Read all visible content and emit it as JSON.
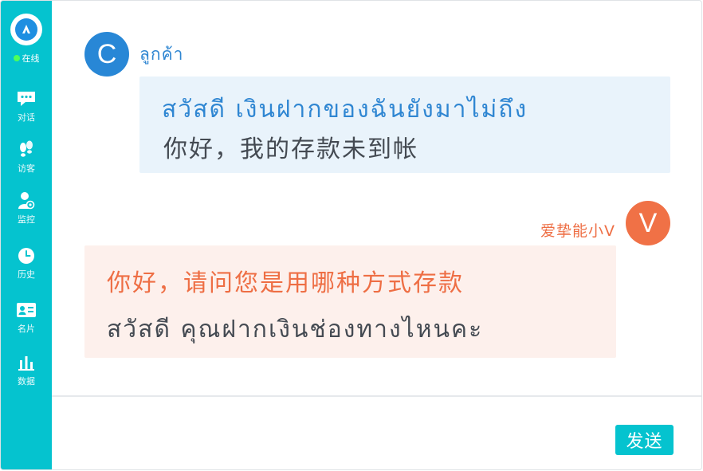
{
  "sidebar": {
    "status_label": "在线",
    "items": [
      {
        "label": "对话",
        "icon": "chat-icon"
      },
      {
        "label": "访客",
        "icon": "footprints-icon"
      },
      {
        "label": "监控",
        "icon": "user-eye-icon"
      },
      {
        "label": "历史",
        "icon": "clock-icon"
      },
      {
        "label": "名片",
        "icon": "id-card-icon"
      },
      {
        "label": "数据",
        "icon": "bar-chart-icon"
      }
    ],
    "colors": {
      "background": "#05c3cf",
      "online": "#4dff5a"
    }
  },
  "messages": [
    {
      "sender": "ลูกค้า",
      "avatar_letter": "C",
      "lines": [
        "สวัสดี เงินฝากของฉันยังมาไม่ถึง",
        "你好，我的存款未到帐"
      ],
      "accent": "#2f86d2"
    },
    {
      "sender": "爱挚能小V",
      "avatar_letter": "V",
      "lines": [
        "你好，请问您是用哪种方式存款",
        "สวัสดี คุณฝากเงินช่องทางไหนคะ"
      ],
      "accent": "#ee6e44"
    }
  ],
  "composer": {
    "value": "",
    "send_label": "发送"
  }
}
